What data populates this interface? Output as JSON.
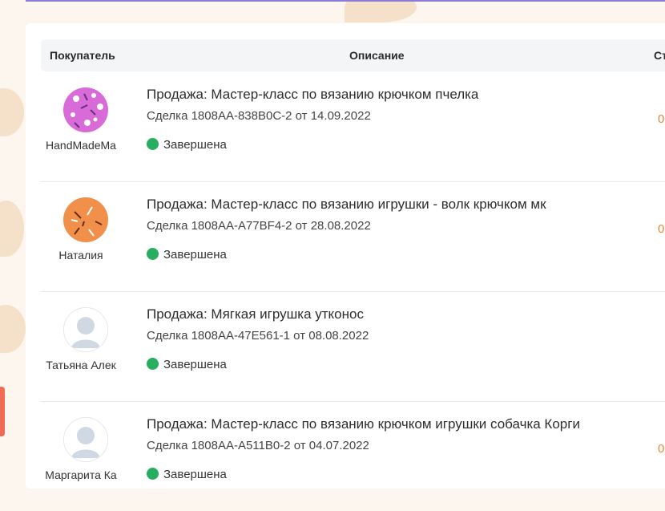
{
  "table": {
    "headers": {
      "buyer": "Покупатель",
      "description": "Описание",
      "status": "Ст"
    },
    "rows": [
      {
        "buyer": "HandMadeMa",
        "avatar": "pink-dotted-avatar",
        "title": "Продажа: Мастер-класс по вязанию крючком пчелка",
        "deal": "Сделка 1808AA-838B0C-2 от 14.09.2022",
        "status": "Завершена",
        "amount": "0"
      },
      {
        "buyer": "Наталия",
        "avatar": "orange-sprinkles-avatar",
        "title": "Продажа: Мастер-класс по вязанию игрушки - волк крючком мк",
        "deal": "Сделка 1808AA-A77BF4-2 от 28.08.2022",
        "status": "Завершена",
        "amount": "0"
      },
      {
        "buyer": "Татьяна Алек",
        "avatar": "default-user-avatar",
        "title": "Продажа: Мягкая игрушка утконос",
        "deal": "Сделка 1808AA-47E561-1 от 08.08.2022",
        "status": "Завершена",
        "amount": ""
      },
      {
        "buyer": "Маргарита Ка",
        "avatar": "default-user-avatar",
        "title": "Продажа: Мастер-класс по вязанию крючком игрушки собачка Корги",
        "deal": "Сделка 1808AA-A511B0-2 от 04.07.2022",
        "status": "Завершена",
        "amount": "0"
      }
    ]
  },
  "colors": {
    "status_complete": "#27ae60",
    "amount": "#e8863a",
    "header_bg": "#f3f5f7"
  }
}
